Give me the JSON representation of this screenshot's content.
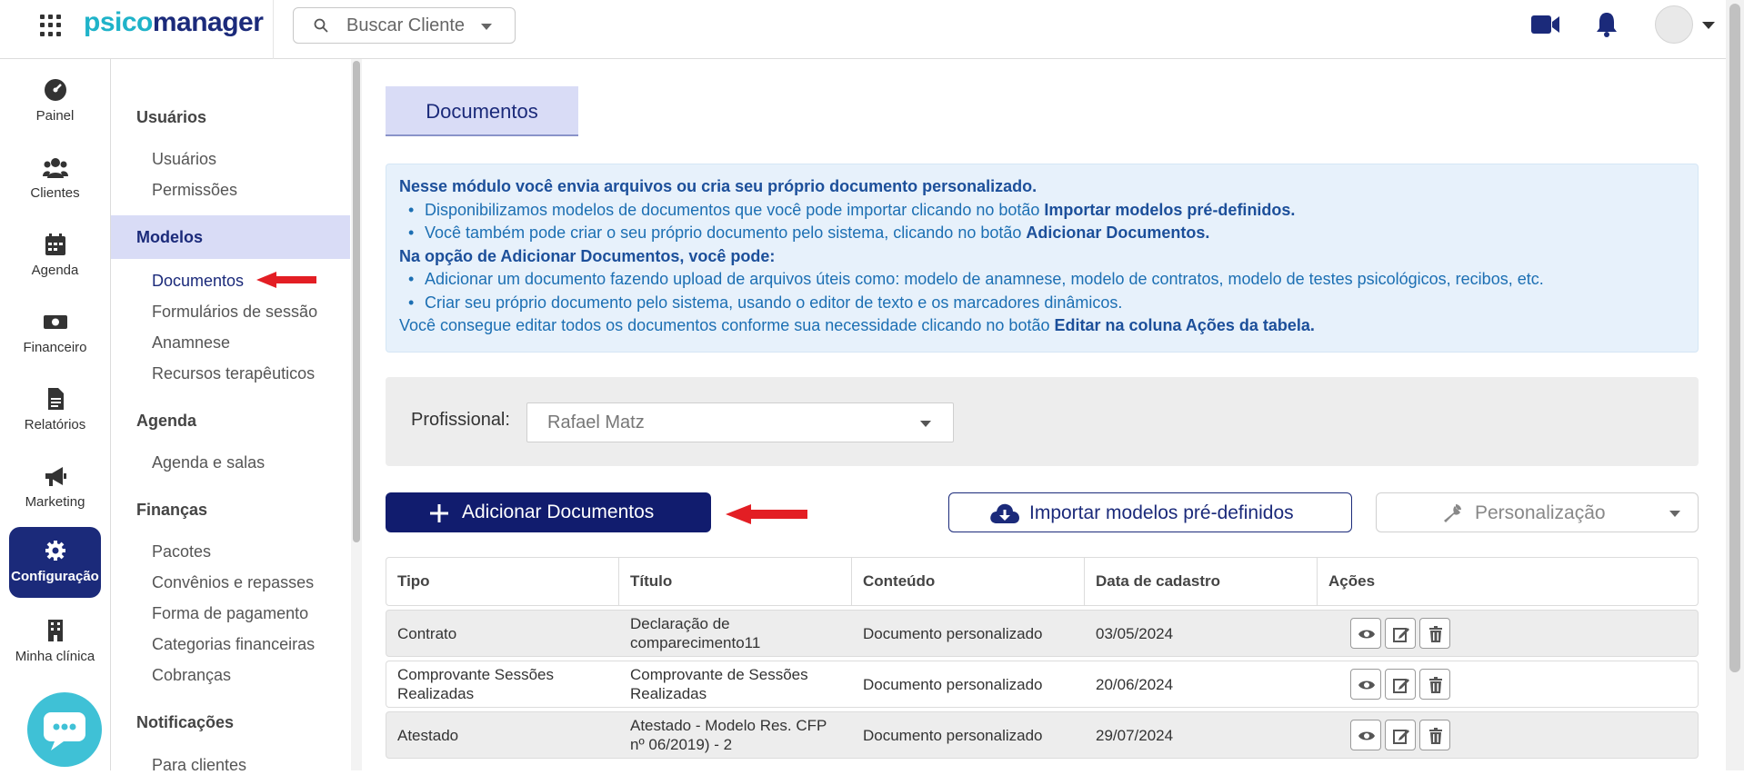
{
  "topbar": {
    "logo_part1": "psico",
    "logo_part2": "manager",
    "search_placeholder": "Buscar Cliente"
  },
  "rail": {
    "items": [
      {
        "label": "Painel",
        "icon": "gauge-icon"
      },
      {
        "label": "Clientes",
        "icon": "users-icon"
      },
      {
        "label": "Agenda",
        "icon": "calendar-icon"
      },
      {
        "label": "Financeiro",
        "icon": "money-icon"
      },
      {
        "label": "Relatórios",
        "icon": "report-icon"
      },
      {
        "label": "Marketing",
        "icon": "megaphone-icon"
      },
      {
        "label": "Configuração",
        "icon": "gear-icon",
        "active": true
      },
      {
        "label": "Minha clínica",
        "icon": "building-icon"
      }
    ]
  },
  "sidebar": {
    "usuarios_title": "Usuários",
    "usuarios_items": [
      "Usuários",
      "Permissões"
    ],
    "modelos_title": "Modelos",
    "modelos_items": [
      "Documentos",
      "Formulários de sessão",
      "Anamnese",
      "Recursos terapêuticos"
    ],
    "agenda_title": "Agenda",
    "agenda_items": [
      "Agenda e salas"
    ],
    "financas_title": "Finanças",
    "financas_items": [
      "Pacotes",
      "Convênios e repasses",
      "Forma de pagamento",
      "Categorias financeiras",
      "Cobranças"
    ],
    "notificacoes_title": "Notificações",
    "notificacoes_items": [
      "Para clientes"
    ]
  },
  "main": {
    "page_title": "Documentos",
    "info": {
      "line1": "Nesse módulo você envia arquivos ou cria seu próprio documento personalizado.",
      "bullet1_text": "Disponibilizamos modelos de documentos que você pode importar clicando no botão ",
      "bullet1_bold": "Importar modelos pré-definidos.",
      "bullet2_text": "Você também pode criar o seu próprio documento pelo sistema, clicando no botão ",
      "bullet2_bold": "Adicionar Documentos.",
      "line2": "Na opção de Adicionar Documentos, você pode:",
      "bullet3": "Adicionar um documento fazendo upload de arquivos úteis como: modelo de anamnese, modelo de contratos, modelo de testes psicológicos, recibos, etc.",
      "bullet4": "Criar seu próprio documento pelo sistema, usando o editor de texto e os marcadores dinâmicos.",
      "line3_text": "Você consegue editar todos os documentos conforme sua necessidade clicando no botão ",
      "line3_bold": "Editar na coluna Ações da tabela."
    },
    "filter": {
      "label": "Profissional:",
      "value": "Rafael Matz"
    },
    "buttons": {
      "add": "Adicionar Documentos",
      "import": "Importar modelos pré-definidos",
      "custom": "Personalização"
    },
    "table": {
      "headers": [
        "Tipo",
        "Título",
        "Conteúdo",
        "Data de cadastro",
        "Ações"
      ],
      "rows": [
        {
          "tipo": "Contrato",
          "titulo": "Declaração de comparecimento11",
          "conteudo": "Documento personalizado",
          "data": "03/05/2024"
        },
        {
          "tipo": "Comprovante Sessões Realizadas",
          "titulo": "Comprovante de Sessões Realizadas",
          "conteudo": "Documento personalizado",
          "data": "20/06/2024"
        },
        {
          "tipo": "Atestado",
          "titulo": "Atestado - Modelo Res. CFP nº 06/2019) - 2",
          "conteudo": "Documento personalizado",
          "data": "29/07/2024"
        }
      ]
    }
  },
  "colors": {
    "brand_navy": "#1b2a7a",
    "brand_teal": "#1fb3c9",
    "info_text": "#1c6fb3",
    "active_tab_bg": "#d9dcf6",
    "annotation_arrow": "#e31e24"
  }
}
